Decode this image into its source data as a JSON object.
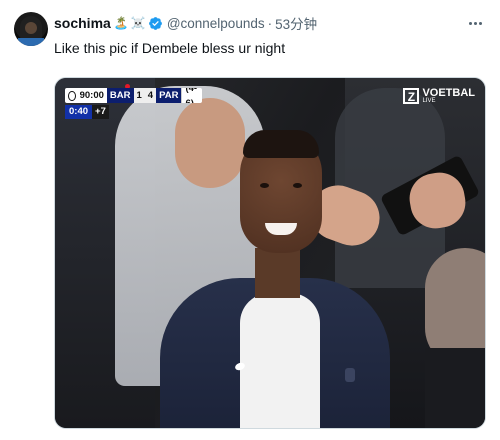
{
  "tweet": {
    "author_name": "sochima",
    "author_emojis": [
      "🏝️",
      "☠️"
    ],
    "handle": "@connelpounds",
    "separator": "·",
    "time": "53分钟",
    "text": "Like this pic if Dembele bless ur night"
  },
  "media": {
    "scoreboard": {
      "clock": "90:00",
      "home_team": "BAR",
      "home_score": "1",
      "away_score": "4",
      "away_team": "PAR",
      "aggregate": "(4-6)",
      "extra_minute": "0:40",
      "added_time": "+7"
    },
    "broadcaster": {
      "logo_letter": "Z",
      "name": "VOETBAL",
      "tag": "LIVE"
    }
  },
  "colors": {
    "verified": "#1d9bf0",
    "scoreboard_team_bg": "#0c1e6e",
    "scoreboard_minute_bg": "#1231a8"
  }
}
